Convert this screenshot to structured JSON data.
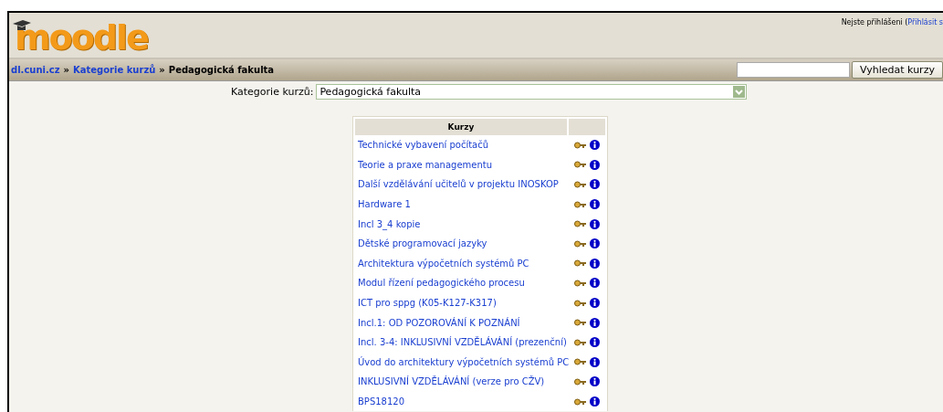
{
  "logo": {
    "text": "moodle"
  },
  "login": {
    "text": "Nejste přihlášeni (",
    "link": "Přihlásit s"
  },
  "breadcrumb": [
    {
      "label": "dl.cuni.cz",
      "link": true
    },
    {
      "separator": "»"
    },
    {
      "label": "Kategorie kurzů",
      "link": true
    },
    {
      "separator": "»"
    },
    {
      "label": "Pedagogická fakulta",
      "link": false
    }
  ],
  "search": {
    "button": "Vyhledat kurzy"
  },
  "category": {
    "label": "Kategorie kurzů:",
    "value": "Pedagogická fakulta"
  },
  "table": {
    "columns": [
      "Kurzy"
    ],
    "rows": [
      {
        "name": "Technické vybavení počítačů"
      },
      {
        "name": "Teorie a praxe managementu"
      },
      {
        "name": "Další vzdělávání učitelů v projektu INOSKOP"
      },
      {
        "name": "Hardware 1"
      },
      {
        "name": "Incl 3_4 kopie"
      },
      {
        "name": "Dětské programovací jazyky"
      },
      {
        "name": "Architektura výpočetních systémů PC"
      },
      {
        "name": "Modul řízení pedagogického procesu"
      },
      {
        "name": "ICT pro sppg (K05-K127-K317)"
      },
      {
        "name": "Incl.1: OD POZOROVÁNÍ K POZNÁNÍ"
      },
      {
        "name": "Incl. 3-4: INKLUSIVNÍ VZDĚLÁVÁNÍ (prezenční)"
      },
      {
        "name": "Úvod do architektury výpočetních systémů PC"
      },
      {
        "name": "INKLUSIVNÍ VZDĚLÁVÁNÍ (verze pro CŽV)"
      },
      {
        "name": "BPS18120"
      }
    ]
  }
}
